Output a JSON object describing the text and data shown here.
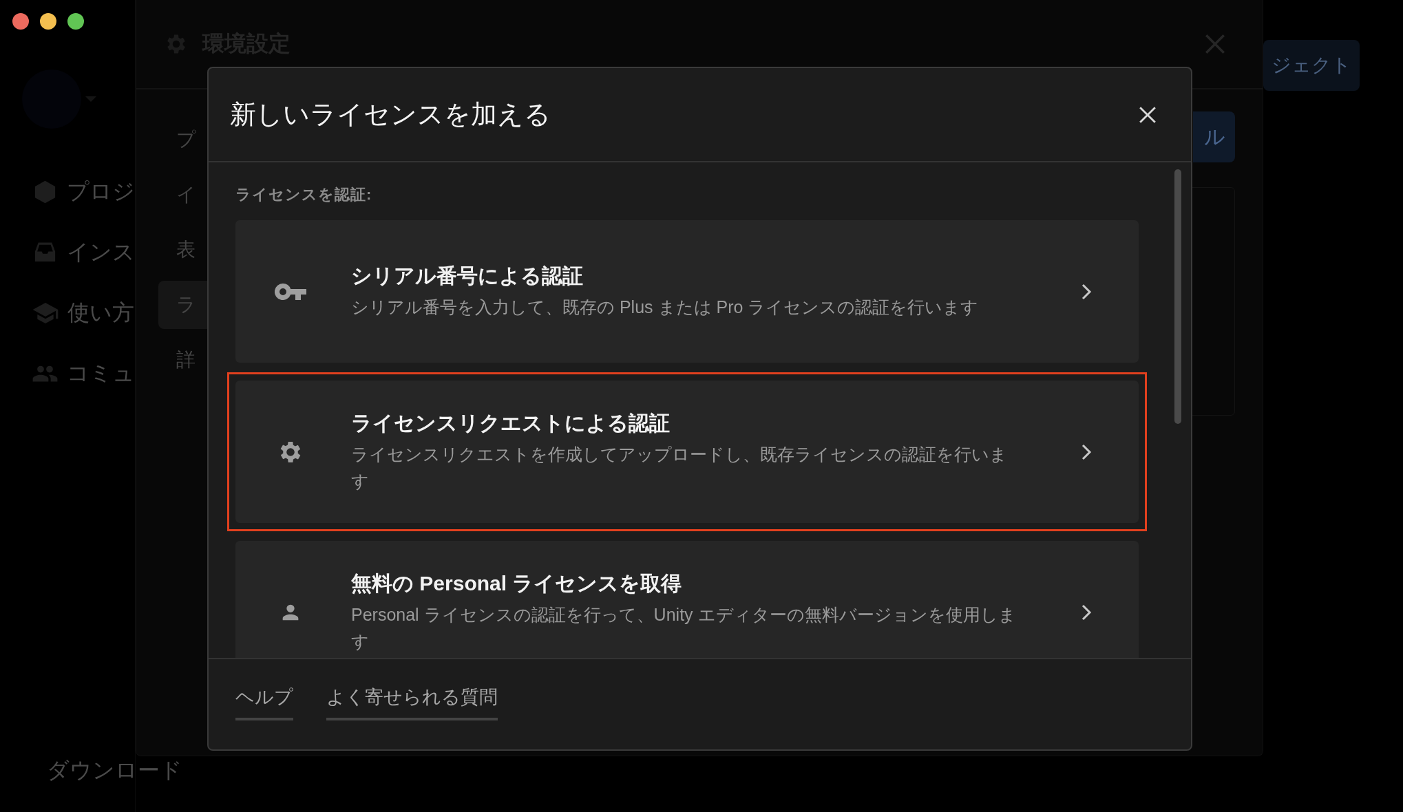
{
  "window": {
    "controls": [
      {
        "color": "#ec6a5e"
      },
      {
        "color": "#f4bf4f"
      },
      {
        "color": "#61c554"
      }
    ]
  },
  "sidebar": {
    "items": [
      {
        "kind": "cube",
        "label": "プロジ"
      },
      {
        "kind": "tray",
        "label": "インス"
      },
      {
        "kind": "cap",
        "label": "使い方"
      },
      {
        "kind": "people",
        "label": "コミュ"
      }
    ],
    "footer_item": {
      "kind": "download",
      "label": "ダウンロード"
    }
  },
  "header_button": "ジェクト",
  "preferences": {
    "title": "環境設定",
    "nav": [
      {
        "label": "プ",
        "selected": false
      },
      {
        "label": "イ",
        "selected": false
      },
      {
        "label": "表",
        "selected": false
      },
      {
        "label": "ラ",
        "selected": true
      },
      {
        "label": "詳",
        "selected": false
      }
    ],
    "primary_button": "ル"
  },
  "dialog": {
    "title": "新しいライセンスを加える",
    "section_label": "ライセンスを認証:",
    "options": [
      {
        "kind": "key",
        "title": "シリアル番号による認証",
        "description": "シリアル番号を入力して、既存の Plus または Pro ライセンスの認証を行います",
        "highlighted": false
      },
      {
        "kind": "gear",
        "title": "ライセンスリクエストによる認証",
        "description": "ライセンスリクエストを作成してアップロードし、既存ライセンスの認証を行います",
        "highlighted": true
      },
      {
        "kind": "person",
        "title": "無料の Personal ライセンスを取得",
        "description": "Personal ライセンスの認証を行って、Unity エディターの無料バージョンを使用します",
        "highlighted": false
      }
    ],
    "footer_links": [
      "ヘルプ",
      "よく寄せられる質問"
    ]
  }
}
